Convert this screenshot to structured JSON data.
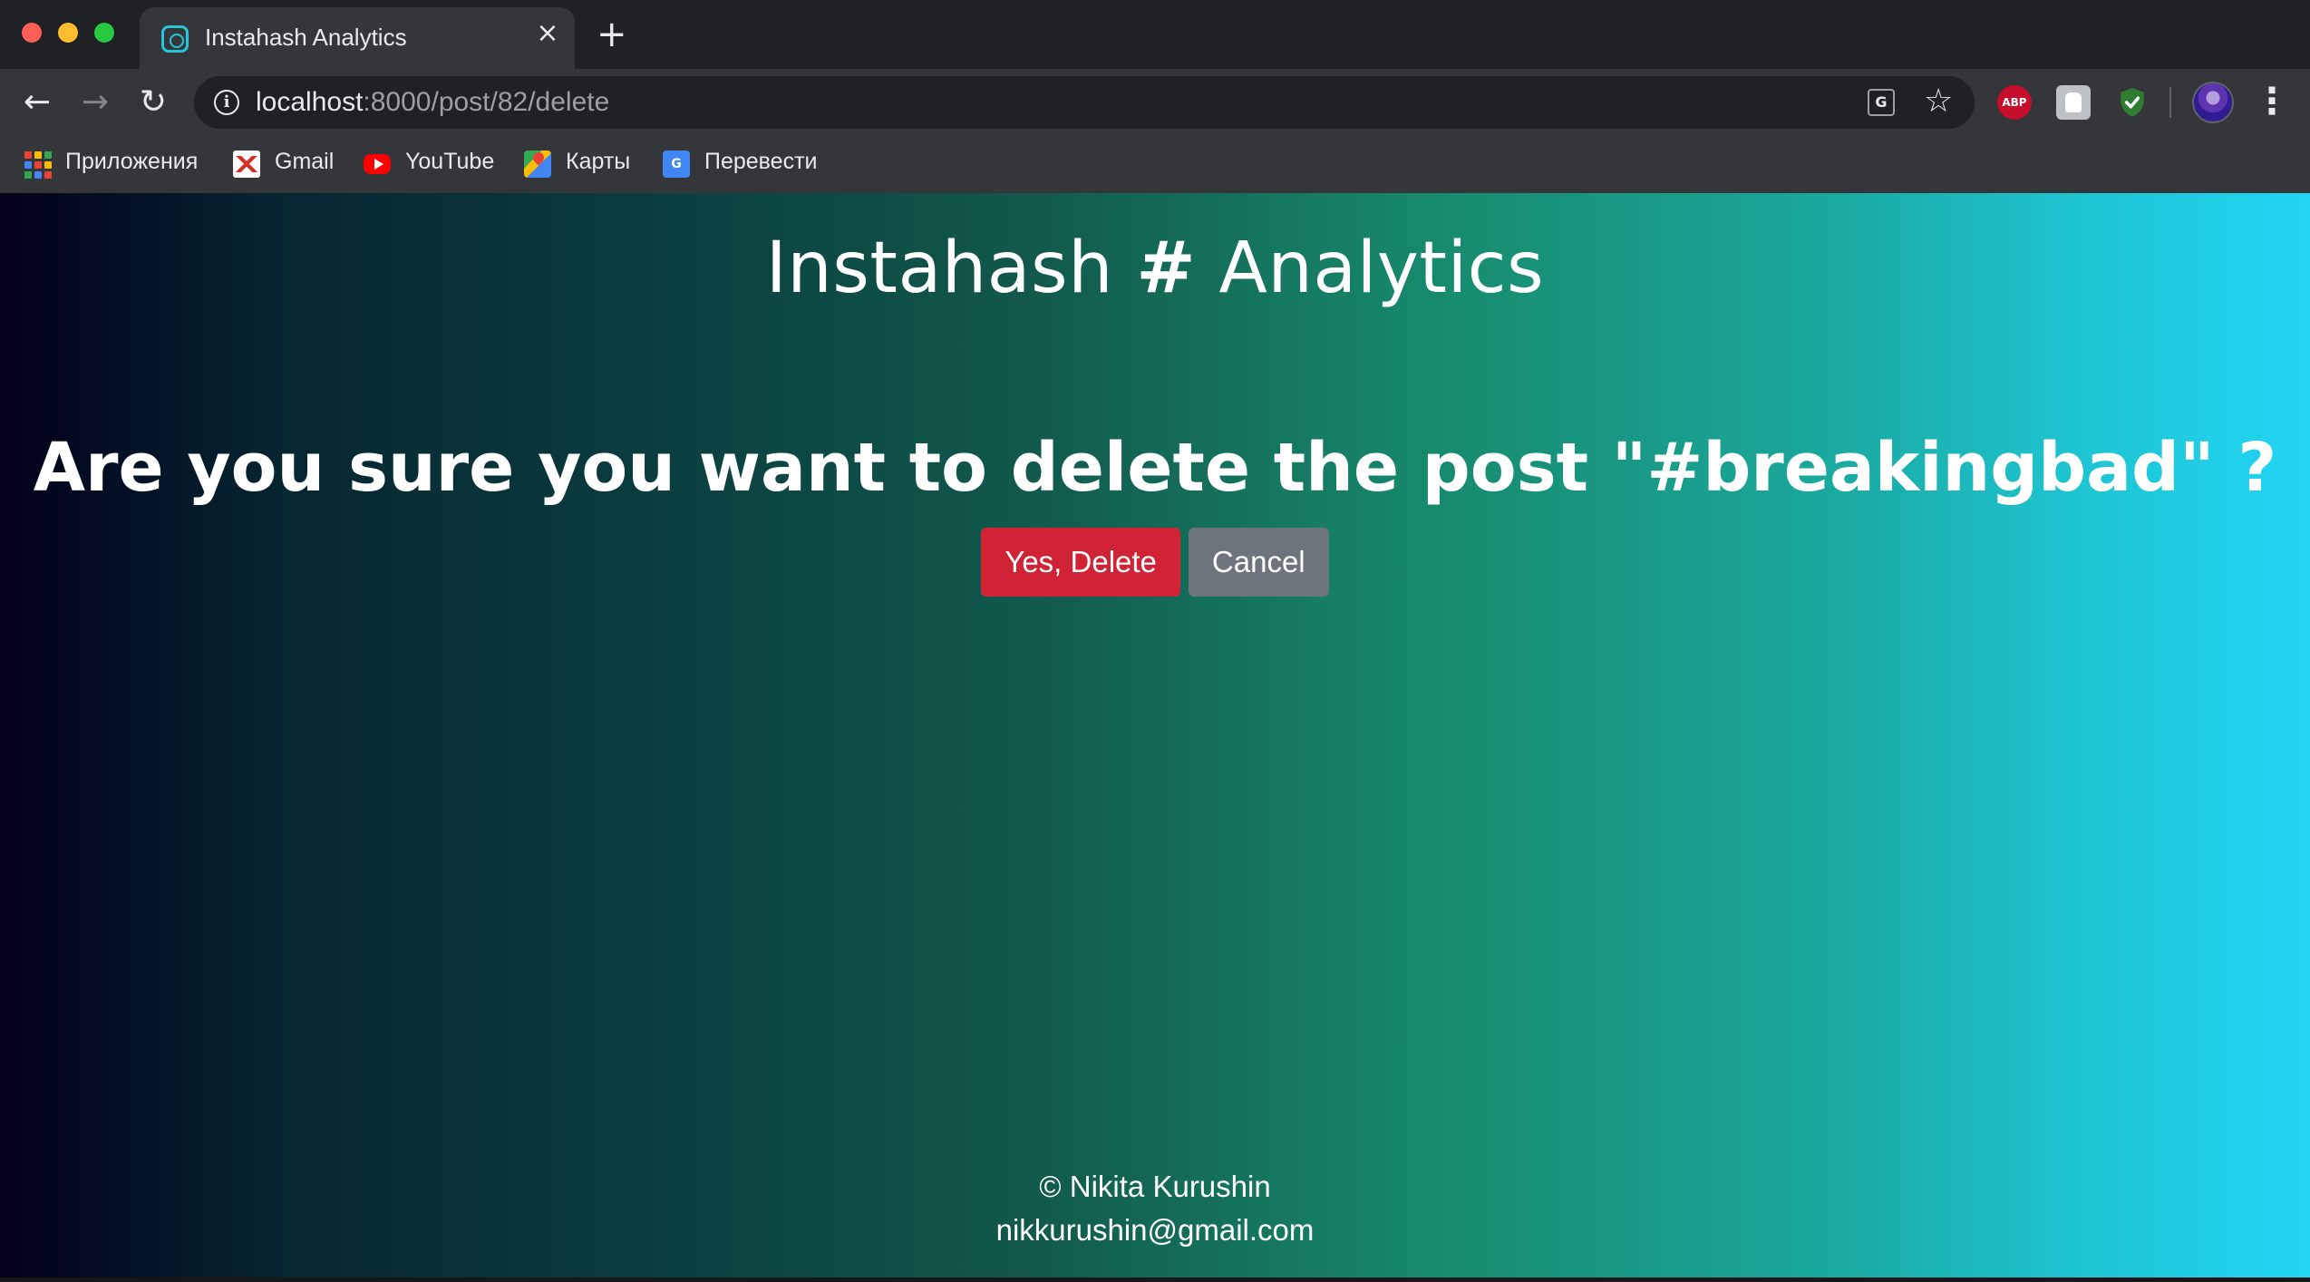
{
  "browser": {
    "tab": {
      "title": "Instahash Analytics",
      "close_icon": "×",
      "favicon": "instagram-icon"
    },
    "new_tab_label": "+",
    "nav": {
      "back": "←",
      "forward": "→",
      "reload": "↻"
    },
    "address": {
      "host": "localhost",
      "rest": ":8000/post/82/delete"
    },
    "omnibox_icons": {
      "translate": "G",
      "star": "☆"
    },
    "extensions": {
      "abp_label": "ABP"
    },
    "menu": "⋮",
    "bookmarks": [
      {
        "label": "Приложения",
        "icon": "apps-grid-icon"
      },
      {
        "label": "Gmail",
        "icon": "gmail-icon"
      },
      {
        "label": "YouTube",
        "icon": "youtube-icon"
      },
      {
        "label": "Карты",
        "icon": "maps-icon"
      },
      {
        "label": "Перевести",
        "icon": "google-translate-icon"
      }
    ]
  },
  "page": {
    "title_left": "Instahash ",
    "title_hash": "#",
    "title_right": " Analytics",
    "question": "Are you sure you want to delete the post \"#breakingbad\" ?",
    "buttons": {
      "confirm": "Yes, Delete",
      "cancel": "Cancel"
    },
    "footer": {
      "copyright": "© Nikita Kurushin",
      "email": "nikkurushin@gmail.com"
    }
  },
  "colors": {
    "danger": "#d12336",
    "secondary": "#6c757d",
    "gradient_start": "#02001a",
    "gradient_end": "#22d5f4"
  }
}
